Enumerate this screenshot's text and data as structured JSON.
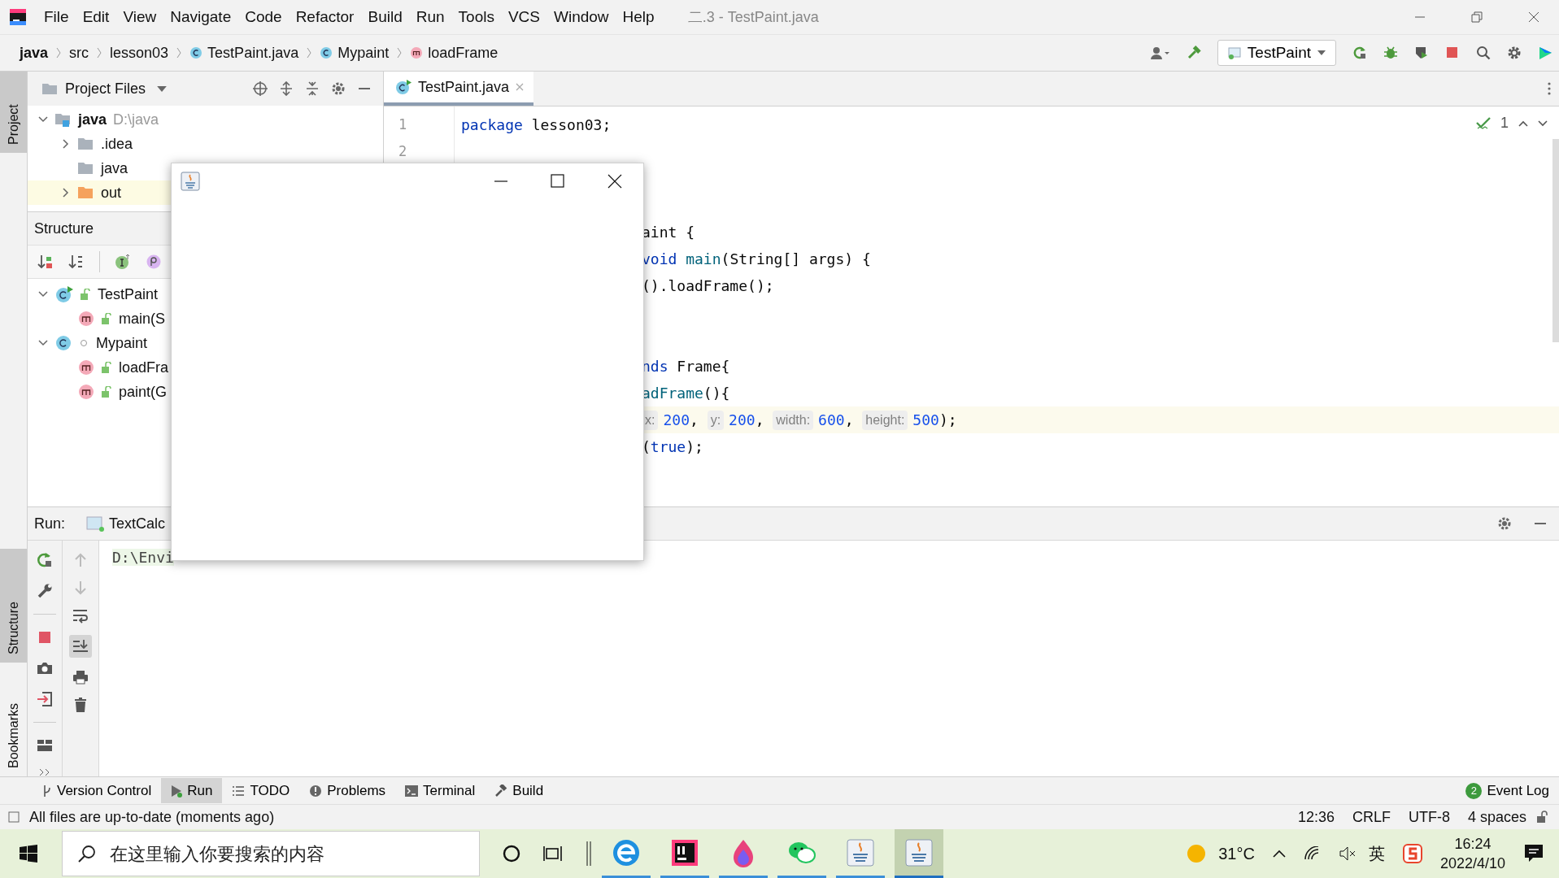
{
  "window": {
    "title": "二.3 - TestPaint.java"
  },
  "menu": [
    "File",
    "Edit",
    "View",
    "Navigate",
    "Code",
    "Refactor",
    "Build",
    "Run",
    "Tools",
    "VCS",
    "Window",
    "Help"
  ],
  "breadcrumbs": [
    {
      "label": "java",
      "kind": "root"
    },
    {
      "label": "src",
      "kind": "folder"
    },
    {
      "label": "lesson03",
      "kind": "folder"
    },
    {
      "label": "TestPaint.java",
      "kind": "runclass"
    },
    {
      "label": "Mypaint",
      "kind": "class"
    },
    {
      "label": "loadFrame",
      "kind": "method"
    }
  ],
  "run_config": {
    "label": "TestPaint"
  },
  "side_stripe": [
    {
      "label": "Project",
      "selected": true
    },
    {
      "label": "Structure",
      "selected": true
    },
    {
      "label": "Bookmarks",
      "selected": false
    }
  ],
  "project_panel": {
    "title": "Project Files",
    "tree": [
      {
        "label": "java",
        "hint": "D:\\java",
        "kind": "module",
        "expanded": true,
        "children": [
          {
            "label": ".idea",
            "kind": "folder",
            "expanded": false
          },
          {
            "label": "java",
            "kind": "folder"
          },
          {
            "label": "out",
            "kind": "excluded",
            "expanded": false
          }
        ]
      }
    ]
  },
  "structure_panel": {
    "title": "Structure",
    "tree": [
      {
        "label": "TestPaint",
        "kind": "runclass",
        "public": true,
        "expanded": true,
        "children": [
          {
            "label": "main(S",
            "kind": "method",
            "public": true
          }
        ]
      },
      {
        "label": "Mypaint",
        "kind": "class",
        "public": false,
        "expanded": true,
        "children": [
          {
            "label": "loadFra",
            "kind": "method",
            "public": true
          },
          {
            "label": "paint(G",
            "kind": "method",
            "public": true
          }
        ]
      }
    ]
  },
  "editor": {
    "tabs": [
      {
        "label": "TestPaint.java",
        "selected": true
      }
    ],
    "inspections": "1",
    "lines": [
      {
        "number": "1",
        "kind": "code",
        "tokens": [
          {
            "text": "package",
            "kind": "keyword"
          },
          {
            "text": " lesson03;",
            "kind": "plain"
          }
        ]
      },
      {
        "number": "2",
        "kind": "blank"
      },
      {
        "kind": "blank"
      },
      {
        "kind": "blank"
      },
      {
        "kind": "fragment",
        "tokens": [
          {
            "text": "aint {",
            "kind": "plain"
          }
        ]
      },
      {
        "kind": "fragment",
        "tokens": [
          {
            "text": "void",
            "kind": "keyword"
          },
          {
            "text": " main",
            "kind": "method"
          },
          {
            "text": "(String[] args) {",
            "kind": "plain"
          }
        ]
      },
      {
        "kind": "fragment",
        "tokens": [
          {
            "text": "().loadFrame();",
            "kind": "plain"
          }
        ]
      },
      {
        "kind": "blank"
      },
      {
        "kind": "blank"
      },
      {
        "kind": "fragment",
        "tokens": [
          {
            "text": "nds",
            "kind": "keyword"
          },
          {
            "text": " Frame{",
            "kind": "plain"
          }
        ]
      },
      {
        "kind": "fragment",
        "tokens": [
          {
            "text": "adFrame",
            "kind": "method"
          },
          {
            "text": "(){",
            "kind": "plain"
          }
        ]
      },
      {
        "kind": "fragment",
        "current": true,
        "tokens": [
          {
            "text": "x:",
            "kind": "hint"
          },
          {
            "text": "200",
            "kind": "number"
          },
          {
            "text": ", ",
            "kind": "plain"
          },
          {
            "text": "y:",
            "kind": "hint"
          },
          {
            "text": "200",
            "kind": "number"
          },
          {
            "text": ", ",
            "kind": "plain"
          },
          {
            "text": "width:",
            "kind": "hint"
          },
          {
            "text": "600",
            "kind": "number"
          },
          {
            "text": ", ",
            "kind": "plain"
          },
          {
            "text": "height:",
            "kind": "hint"
          },
          {
            "text": "500",
            "kind": "number"
          },
          {
            "text": ");",
            "kind": "plain"
          }
        ]
      },
      {
        "kind": "fragment",
        "tokens": [
          {
            "text": "(",
            "kind": "plain"
          },
          {
            "text": "true",
            "kind": "keyword"
          },
          {
            "text": ");",
            "kind": "plain"
          }
        ]
      }
    ]
  },
  "run_panel": {
    "label": "Run:",
    "tab": "TextCalc",
    "console": "D:\\Envi"
  },
  "tool_tabs": [
    {
      "label": "Version Control",
      "kind": "vcs",
      "selected": false
    },
    {
      "label": "Run",
      "kind": "run",
      "selected": true
    },
    {
      "label": "TODO",
      "kind": "todo",
      "selected": false
    },
    {
      "label": "Problems",
      "kind": "problems",
      "selected": false
    },
    {
      "label": "Terminal",
      "kind": "terminal",
      "selected": false
    },
    {
      "label": "Build",
      "kind": "build",
      "selected": false
    }
  ],
  "event_log": {
    "label": "Event Log",
    "count": "2"
  },
  "status_bar": {
    "message": "All files are up-to-date (moments ago)",
    "items": [
      "12:36",
      "CRLF",
      "UTF-8",
      "4 spaces"
    ]
  },
  "taskbar": {
    "search": {
      "placeholder": "在这里输入你要搜索的内容"
    },
    "apps": [
      {
        "kind": "edge",
        "running": true,
        "selected": false
      },
      {
        "kind": "intellij",
        "running": true,
        "selected": false
      },
      {
        "kind": "flame",
        "running": true,
        "selected": false
      },
      {
        "kind": "wechat",
        "running": true,
        "selected": false
      },
      {
        "kind": "java",
        "running": true,
        "selected": false
      },
      {
        "kind": "java",
        "running": true,
        "selected": true
      }
    ],
    "weather": "31°C",
    "language": "英",
    "time": "16:24",
    "date": "2022/4/10"
  }
}
